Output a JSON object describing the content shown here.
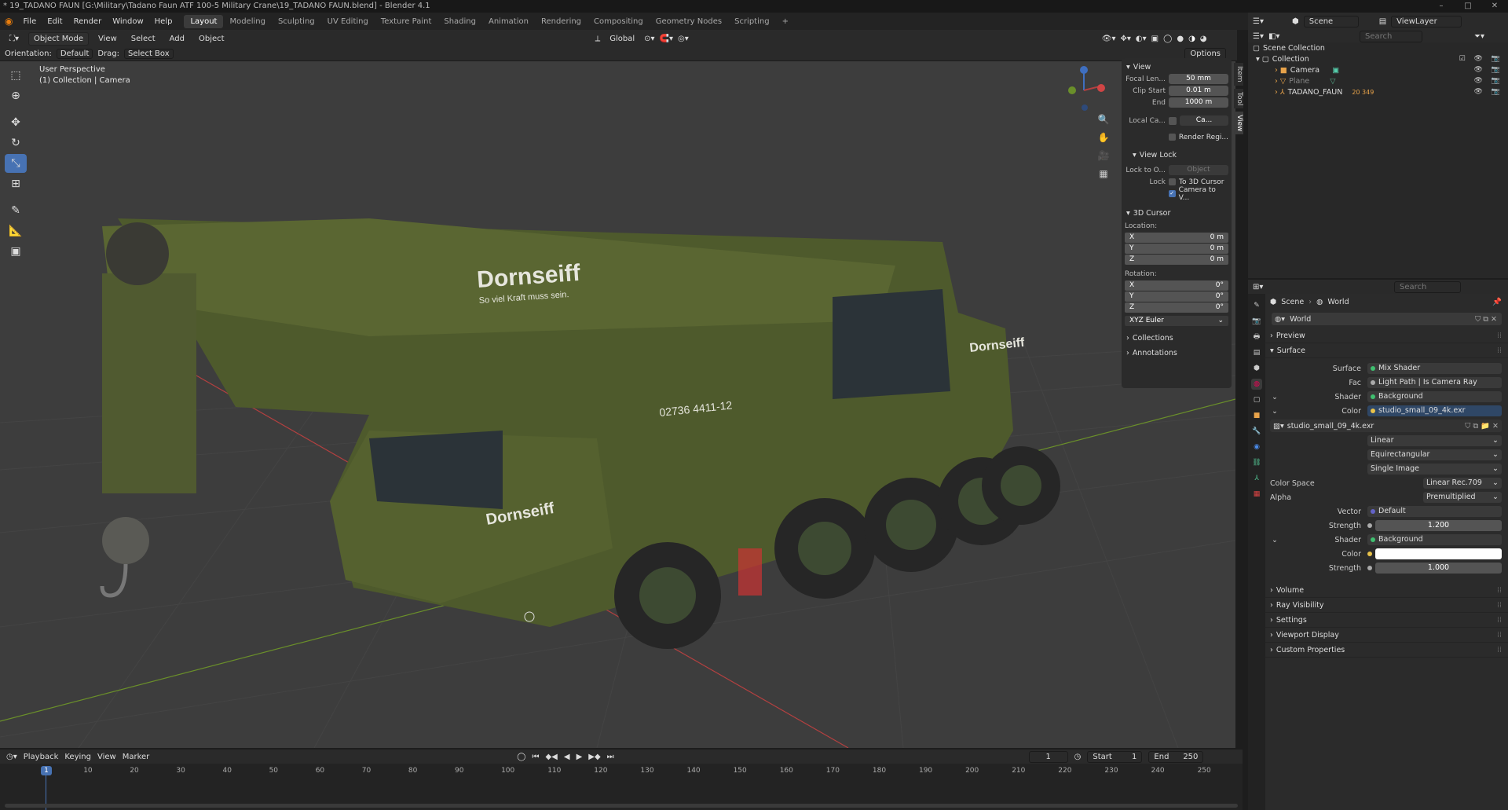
{
  "window": {
    "title": "* 19_TADANO FAUN [G:\\Military\\Tadano Faun ATF 100-5 Military Crane\\19_TADANO FAUN.blend] - Blender 4.1"
  },
  "menus": [
    "File",
    "Edit",
    "Render",
    "Window",
    "Help"
  ],
  "workspaces": [
    "Layout",
    "Modeling",
    "Sculpting",
    "UV Editing",
    "Texture Paint",
    "Shading",
    "Animation",
    "Rendering",
    "Compositing",
    "Geometry Nodes",
    "Scripting",
    "+"
  ],
  "active_workspace": "Layout",
  "scene_selector": "Scene",
  "viewlayer_selector": "ViewLayer",
  "viewport_header": {
    "mode": "Object Mode",
    "menus": [
      "View",
      "Select",
      "Add",
      "Object"
    ],
    "transform_orientation": "Global",
    "options_label": "Options"
  },
  "tool_options": {
    "orientation_label": "Orientation:",
    "orientation_value": "Default",
    "drag_label": "Drag:",
    "drag_value": "Select Box"
  },
  "viewport_info": {
    "line1": "User Perspective",
    "line2": "(1) Collection | Camera"
  },
  "model_decals": {
    "brand": "Dornseiff",
    "slogan": "So viel Kraft muss sein.",
    "phone": "02736 4411-12"
  },
  "npanel": {
    "tabs": [
      "Item",
      "Tool",
      "View"
    ],
    "active_tab": "View",
    "view_section": "View",
    "focal_length_label": "Focal Len...",
    "focal_length": "50 mm",
    "clip_start_label": "Clip Start",
    "clip_start": "0.01 m",
    "clip_end_label": "End",
    "clip_end": "1000 m",
    "local_camera_label": "Local Ca...",
    "local_camera_value": "Ca...",
    "render_region_label": "Render Regi...",
    "view_lock_section": "View Lock",
    "lock_to_object_label": "Lock to O...",
    "lock_to_object_placeholder": "Object",
    "lock_label": "Lock",
    "to_3d_cursor_label": "To 3D Cursor",
    "camera_to_view_label": "Camera to V...",
    "cursor_section": "3D Cursor",
    "location_label": "Location:",
    "location": [
      {
        "axis": "X",
        "value": "0 m"
      },
      {
        "axis": "Y",
        "value": "0 m"
      },
      {
        "axis": "Z",
        "value": "0 m"
      }
    ],
    "rotation_label": "Rotation:",
    "rotation": [
      {
        "axis": "X",
        "value": "0°"
      },
      {
        "axis": "Y",
        "value": "0°"
      },
      {
        "axis": "Z",
        "value": "0°"
      }
    ],
    "rotation_mode": "XYZ Euler",
    "collections_section": "Collections",
    "annotations_section": "Annotations"
  },
  "outliner": {
    "search_placeholder": "Search",
    "scene_collection": "Scene Collection",
    "collection": "Collection",
    "items": [
      {
        "name": "Camera",
        "icon": "camera-icon"
      },
      {
        "name": "Plane",
        "icon": "mesh-icon",
        "dim": true
      },
      {
        "name": "TADANO_FAUN",
        "icon": "armature-icon",
        "badge": "20 349"
      }
    ]
  },
  "properties": {
    "search_placeholder": "Search",
    "breadcrumb_scene": "Scene",
    "breadcrumb_world": "World",
    "world_name": "World",
    "sections_top": [
      "Preview",
      "Surface"
    ],
    "surface_label": "Surface",
    "surface_value": "Mix Shader",
    "fac_label": "Fac",
    "fac_value": "Light Path | Is Camera Ray",
    "shader1_label": "Shader",
    "shader1_value": "Background",
    "color1_label": "Color",
    "color1_value": "studio_small_09_4k.exr",
    "image_name": "studio_small_09_4k.exr",
    "interpolation": "Linear",
    "projection": "Equirectangular",
    "source": "Single Image",
    "color_space_label": "Color Space",
    "color_space": "Linear Rec.709",
    "alpha_label": "Alpha",
    "alpha": "Premultiplied",
    "vector_label": "Vector",
    "vector_value": "Default",
    "strength1_label": "Strength",
    "strength1": "1.200",
    "shader2_label": "Shader",
    "shader2_value": "Background",
    "color2_label": "Color",
    "strength2_label": "Strength",
    "strength2": "1.000",
    "sections_bottom": [
      "Volume",
      "Ray Visibility",
      "Settings",
      "Viewport Display",
      "Custom Properties"
    ]
  },
  "timeline": {
    "menus": [
      "Playback",
      "Keying",
      "View",
      "Marker"
    ],
    "current_frame": "1",
    "start_label": "Start",
    "start": "1",
    "end_label": "End",
    "end": "250",
    "frame_marks": [
      "1",
      "10",
      "20",
      "30",
      "40",
      "50",
      "60",
      "70",
      "80",
      "90",
      "100",
      "110",
      "120",
      "130",
      "140",
      "150",
      "160",
      "170",
      "180",
      "190",
      "200",
      "210",
      "220",
      "230",
      "240",
      "250"
    ]
  },
  "colors": {
    "accent": "#4772b3",
    "crane_green": "#4e5a2c",
    "axis_x": "#b34040",
    "axis_y": "#6a8f2a",
    "axis_z": "#3f6fc0"
  }
}
